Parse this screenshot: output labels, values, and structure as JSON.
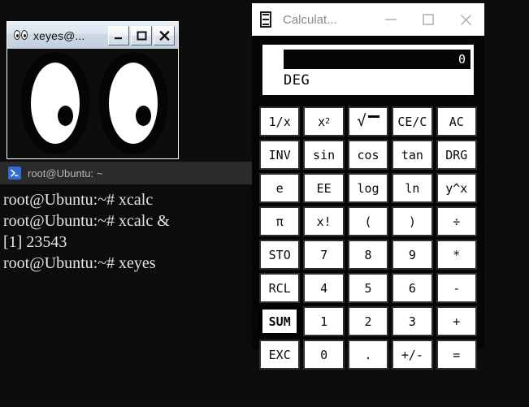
{
  "desktop": {
    "background_color": "#0d0d0d"
  },
  "xeyes_window": {
    "title": "xeyes@...",
    "icon": "eyes-icon",
    "controls": {
      "minimize": "minimize-icon",
      "maximize": "maximize-icon",
      "close": "close-icon"
    },
    "content": {
      "eye_count": 2,
      "description": "two large cartoon eyes tracking the pointer"
    }
  },
  "terminal_window": {
    "title": "root@Ubuntu: ~",
    "icon": "terminal-prompt-icon",
    "lines": [
      "root@Ubuntu:~# xcalc",
      "root@Ubuntu:~# xcalc &",
      "[1] 23543",
      "root@Ubuntu:~# xeyes"
    ]
  },
  "calculator_window": {
    "title": "Calculat...",
    "icon": "calculator-icon",
    "controls": {
      "minimize": "minimize-icon",
      "maximize": "maximize-icon",
      "close": "close-icon"
    },
    "display": {
      "value": "0",
      "mode": "DEG"
    },
    "keys": [
      [
        {
          "label": "1/x",
          "name": "key-reciprocal",
          "selected": false
        },
        {
          "label": "x2",
          "name": "key-square",
          "selected": false,
          "glyph": "superscript2"
        },
        {
          "label": "√",
          "name": "key-square-root",
          "selected": false,
          "glyph": "radical"
        },
        {
          "label": "CE/C",
          "name": "key-clear-entry",
          "selected": false
        },
        {
          "label": "AC",
          "name": "key-all-clear",
          "selected": false
        }
      ],
      [
        {
          "label": "INV",
          "name": "key-inverse",
          "selected": false
        },
        {
          "label": "sin",
          "name": "key-sin",
          "selected": false
        },
        {
          "label": "cos",
          "name": "key-cos",
          "selected": false
        },
        {
          "label": "tan",
          "name": "key-tan",
          "selected": false
        },
        {
          "label": "DRG",
          "name": "key-drg",
          "selected": false
        }
      ],
      [
        {
          "label": "e",
          "name": "key-e",
          "selected": false
        },
        {
          "label": "EE",
          "name": "key-ee",
          "selected": false
        },
        {
          "label": "log",
          "name": "key-log",
          "selected": false
        },
        {
          "label": "ln",
          "name": "key-ln",
          "selected": false
        },
        {
          "label": "y^x",
          "name": "key-power",
          "selected": false
        }
      ],
      [
        {
          "label": "π",
          "name": "key-pi",
          "selected": false
        },
        {
          "label": "x!",
          "name": "key-factorial",
          "selected": false
        },
        {
          "label": "(",
          "name": "key-open-paren",
          "selected": false
        },
        {
          "label": ")",
          "name": "key-close-paren",
          "selected": false
        },
        {
          "label": "÷",
          "name": "key-divide",
          "selected": false
        }
      ],
      [
        {
          "label": "STO",
          "name": "key-store",
          "selected": false
        },
        {
          "label": "7",
          "name": "key-7",
          "selected": false
        },
        {
          "label": "8",
          "name": "key-8",
          "selected": false
        },
        {
          "label": "9",
          "name": "key-9",
          "selected": false
        },
        {
          "label": "*",
          "name": "key-multiply",
          "selected": false
        }
      ],
      [
        {
          "label": "RCL",
          "name": "key-recall",
          "selected": false
        },
        {
          "label": "4",
          "name": "key-4",
          "selected": false
        },
        {
          "label": "5",
          "name": "key-5",
          "selected": false
        },
        {
          "label": "6",
          "name": "key-6",
          "selected": false
        },
        {
          "label": "-",
          "name": "key-subtract",
          "selected": false
        }
      ],
      [
        {
          "label": "SUM",
          "name": "key-sum",
          "selected": true
        },
        {
          "label": "1",
          "name": "key-1",
          "selected": false
        },
        {
          "label": "2",
          "name": "key-2",
          "selected": false
        },
        {
          "label": "3",
          "name": "key-3",
          "selected": false
        },
        {
          "label": "+",
          "name": "key-add",
          "selected": false
        }
      ],
      [
        {
          "label": "EXC",
          "name": "key-exchange",
          "selected": false
        },
        {
          "label": "0",
          "name": "key-0",
          "selected": false
        },
        {
          "label": ".",
          "name": "key-decimal",
          "selected": false
        },
        {
          "label": "+/-",
          "name": "key-sign",
          "selected": false
        },
        {
          "label": "=",
          "name": "key-equals",
          "selected": false
        }
      ]
    ]
  }
}
